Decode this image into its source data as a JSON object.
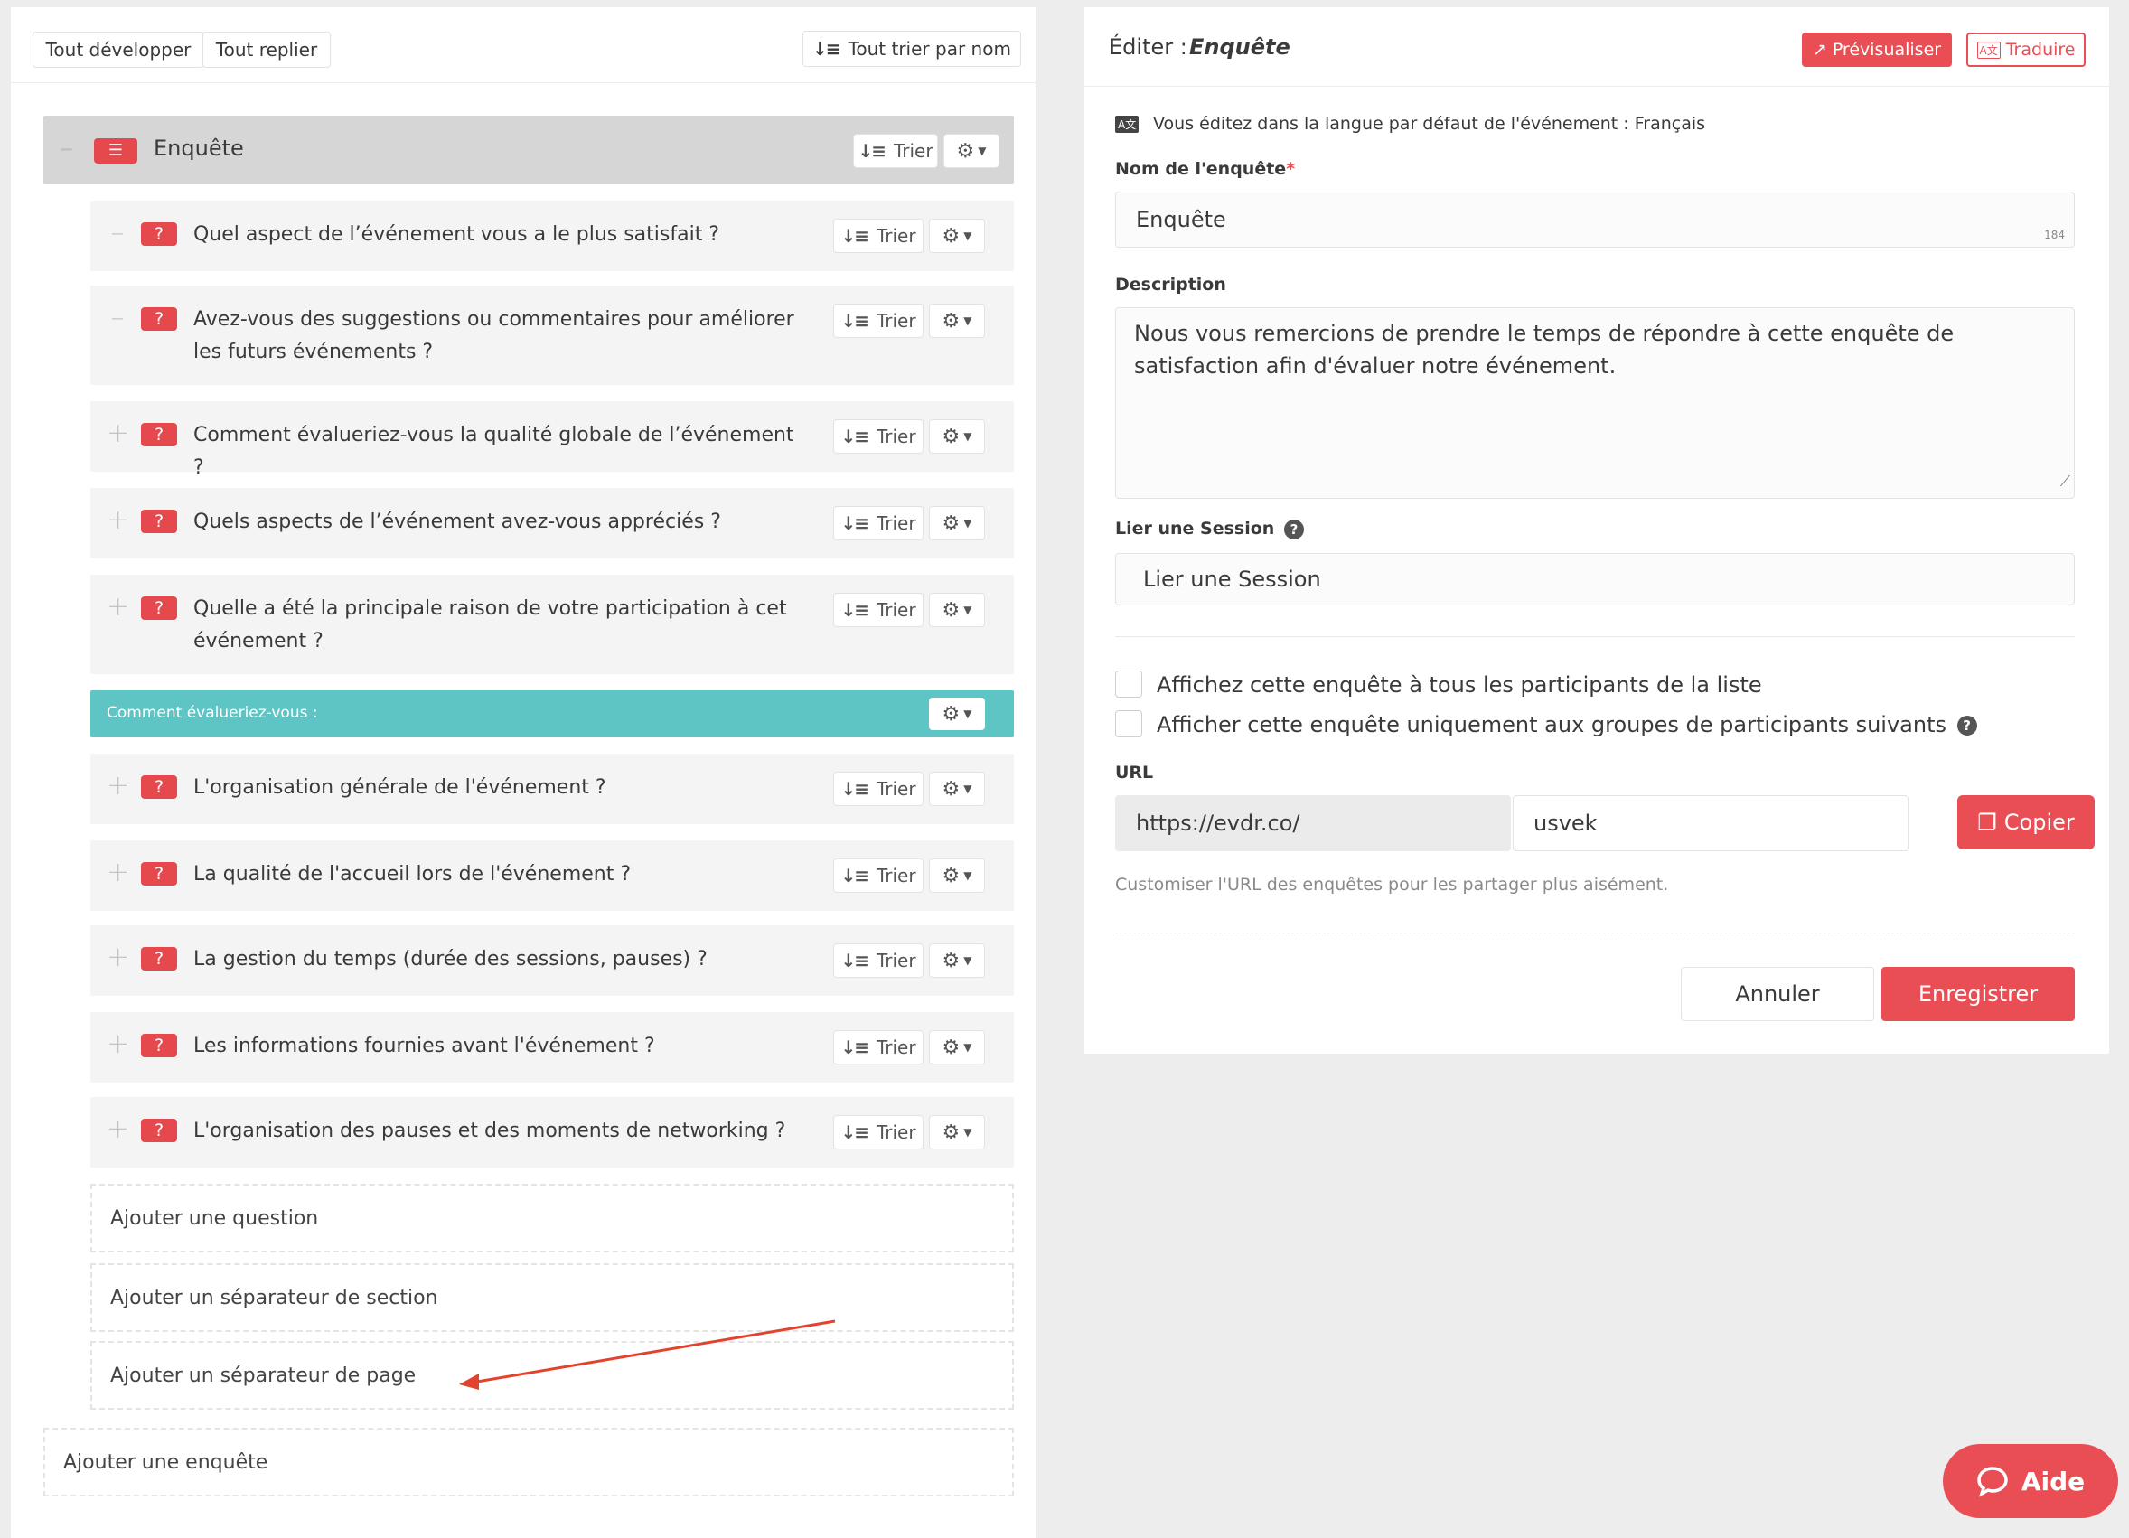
{
  "toolbar": {
    "expand_all": "Tout développer",
    "collapse_all": "Tout replier",
    "sort_all": "Tout trier par nom"
  },
  "survey": {
    "title": "Enquête",
    "sort_label": "Trier"
  },
  "questions": [
    {
      "text": "Quel aspect de l’événement vous a le plus satisfait ?",
      "toggle": "–"
    },
    {
      "text": "Avez-vous des suggestions ou commentaires pour améliorer les futurs événements ?",
      "toggle": "–"
    },
    {
      "text": "Comment évalueriez-vous la qualité globale de l’événement ?",
      "toggle": "+"
    },
    {
      "text": "Quels aspects de l’événement avez-vous appréciés ?",
      "toggle": "+"
    },
    {
      "text": "Quelle a été la principale raison de votre participation à cet événement ?",
      "toggle": "+"
    }
  ],
  "section_separator": {
    "text": "Comment évalueriez-vous :"
  },
  "questions_after": [
    {
      "text": "L'organisation générale de l'événement ?",
      "toggle": "+"
    },
    {
      "text": "La qualité de l'accueil lors de l'événement ?",
      "toggle": "+"
    },
    {
      "text": "La gestion du temps (durée des sessions, pauses) ?",
      "toggle": "+"
    },
    {
      "text": "Les informations fournies avant l'événement ?",
      "toggle": "+"
    },
    {
      "text": "L'organisation des pauses et des moments de networking ?",
      "toggle": "+"
    }
  ],
  "add_actions": {
    "add_question": "Ajouter une question",
    "add_section_separator": "Ajouter un séparateur de section",
    "add_page_separator": "Ajouter un séparateur de page",
    "add_survey": "Ajouter une enquête"
  },
  "editor": {
    "title_prefix": "Éditer :",
    "title_name": "Enquête",
    "preview_button": "Prévisualiser",
    "translate_button": "Traduire",
    "language_notice": "Vous éditez dans la langue par défaut de l'événement : Français",
    "name_label": "Nom de l'enquête",
    "required_mark": "*",
    "name_value": "Enquête",
    "name_char_count": "184",
    "description_label": "Description",
    "description_value": "Nous vous remercions de prendre le temps de répondre à cette enquête de satisfaction afin d'évaluer notre événement.",
    "session_label": "Lier une Session",
    "session_placeholder": "Lier une Session",
    "checkbox_all": "Affichez cette enquête à tous les participants de la liste",
    "checkbox_groups": "Afficher cette enquête uniquement aux groupes de participants suivants",
    "url_label": "URL",
    "url_prefix": "https://evdr.co/",
    "url_slug": "usvek",
    "copy_button": "Copier",
    "url_help": "Customiser l'URL des enquêtes pour les partager plus aisément.",
    "cancel_button": "Annuler",
    "save_button": "Enregistrer"
  },
  "help_widget": {
    "label": "Aide"
  },
  "colors": {
    "accent_red": "#e94e54",
    "section_teal": "#5fc4c4",
    "survey_header_gray": "#d6d6d6"
  }
}
